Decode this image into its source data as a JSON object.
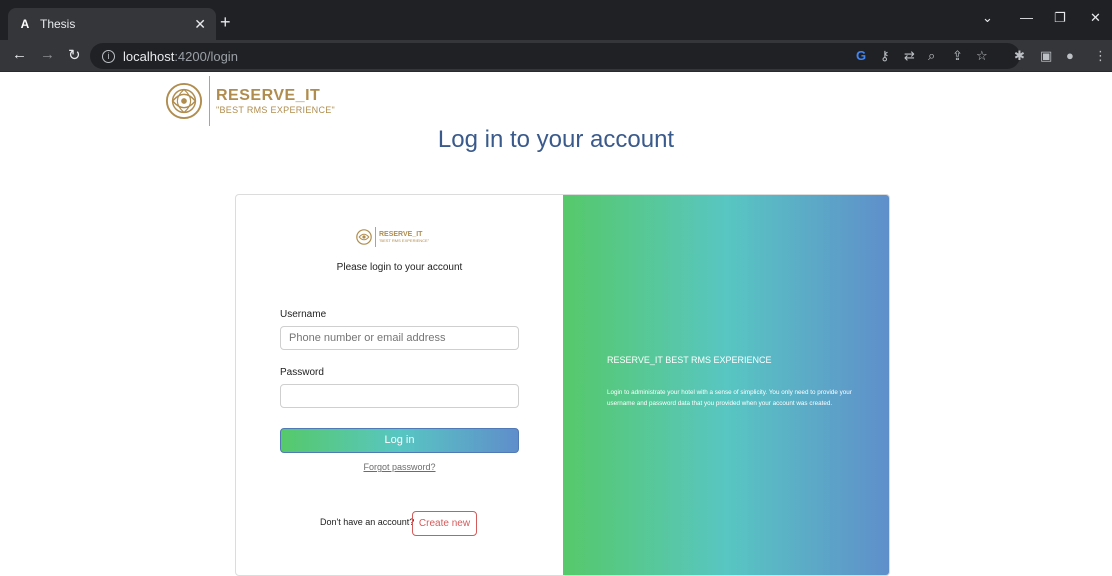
{
  "browser": {
    "tab_title": "Thesis",
    "tab_favicon": "A",
    "url_host": "localhost",
    "url_path": ":4200/login",
    "icons": [
      "back-icon",
      "forward-icon",
      "reload-icon",
      "info-icon",
      "google-icon",
      "key-icon",
      "translate-icon",
      "zoom-icon",
      "share-icon",
      "star-icon",
      "extensions-icon",
      "sidepanel-icon",
      "profile-icon",
      "menu-icon"
    ]
  },
  "brand": {
    "name": "RESERVE_IT",
    "tagline": "\"BEST RMS EXPERIENCE\"",
    "accent": "#b08d4e"
  },
  "page": {
    "heading": "Log in to your account",
    "heading_color": "#3a5a8c"
  },
  "login": {
    "prompt": "Please login to your account",
    "username_label": "Username",
    "username_placeholder": "Phone number or email address",
    "username_value": "",
    "password_label": "Password",
    "password_value": "",
    "login_label": "Log in",
    "forgot_label": "Forgot password?",
    "no_account_text": "Don't have an account?",
    "create_label": "Create new",
    "create_color": "#d45b5b"
  },
  "promo": {
    "title": "RESERVE_IT BEST RMS EXPERIENCE",
    "text": "Login to administrate your hotel with a sense of simplicity. You only need to provide your username and password data that you provided when your account was created.",
    "gradient": [
      "#56c96a",
      "#58c6c2",
      "#5f8ecb"
    ]
  }
}
